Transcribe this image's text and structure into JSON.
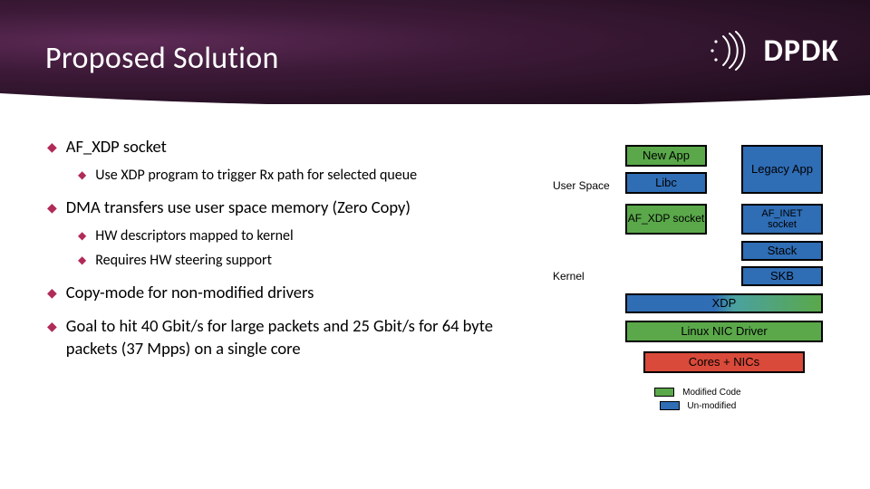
{
  "header": {
    "title": "Proposed Solution",
    "logo_text": "DPDK"
  },
  "bullets": {
    "l1": [
      "AF_XDP socket",
      "DMA transfers use user space memory (Zero Copy)",
      "Copy-mode for non-modified drivers",
      "Goal to hit 40 Gbit/s for large packets and 25 Gbit/s for 64 byte packets (37 Mpps) on a single core"
    ],
    "l2_a": [
      "Use XDP program to trigger Rx path for selected queue"
    ],
    "l2_b": [
      "HW descriptors mapped to kernel",
      "Requires HW steering support"
    ]
  },
  "diagram": {
    "user_space_label": "User Space",
    "kernel_label": "Kernel",
    "new_app": "New App",
    "legacy_app": "Legacy App",
    "libc": "Libc",
    "af_xdp_socket": "AF_XDP socket",
    "af_inet": "AF_INET",
    "socket_word": "socket",
    "stack": "Stack",
    "skb": "SKB",
    "xdp": "XDP",
    "linux_nic_driver": "Linux NIC Driver",
    "cores_nics": "Cores + NICs",
    "legend_modified": "Modified Code",
    "legend_unmodified": "Un-modified"
  }
}
